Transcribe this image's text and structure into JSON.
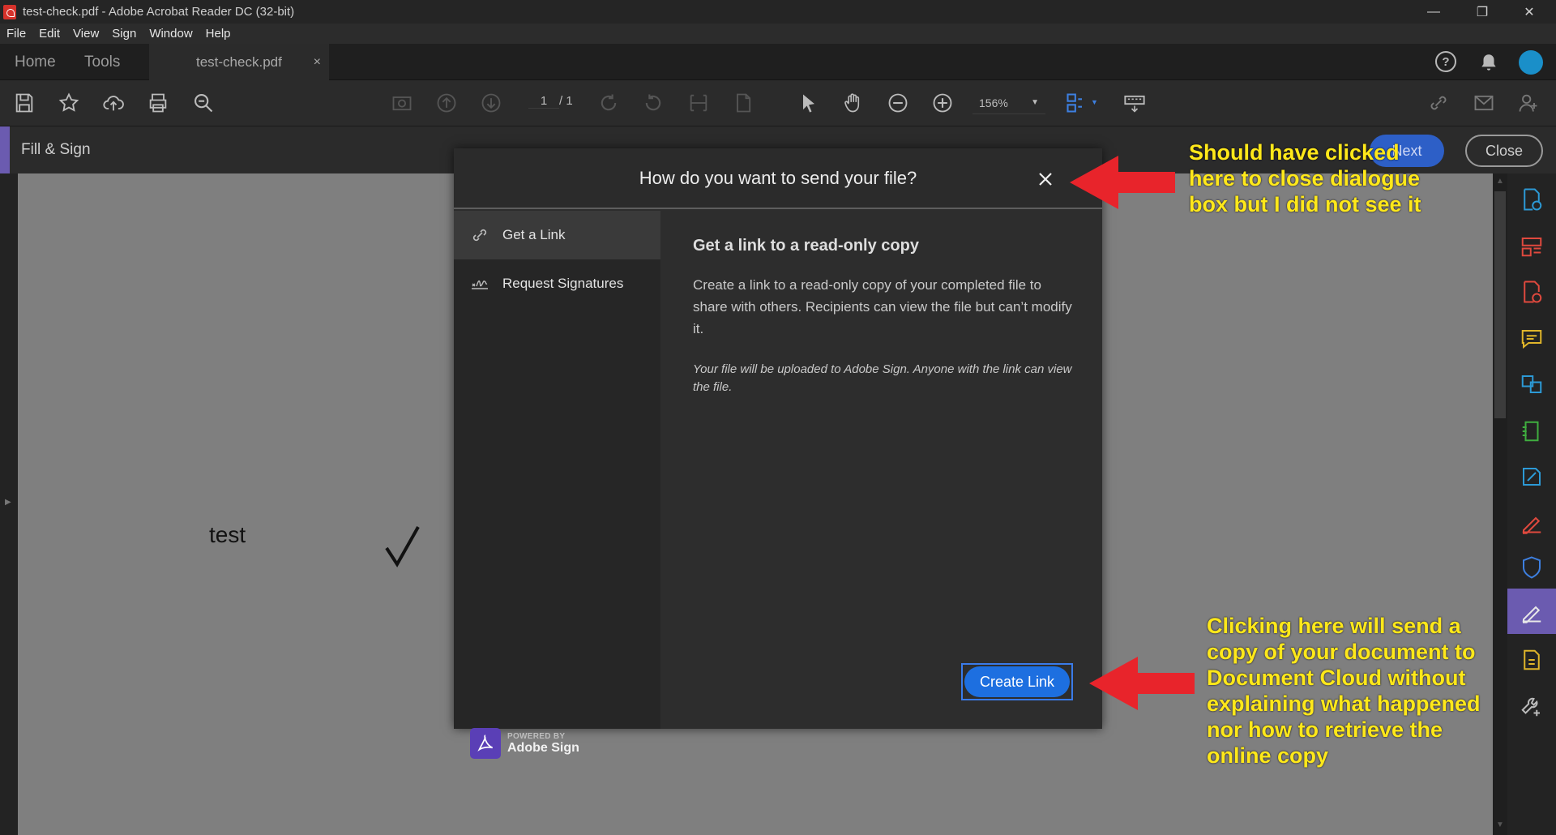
{
  "window": {
    "title": "test-check.pdf - Adobe Acrobat Reader DC (32-bit)",
    "controls": [
      "—",
      "❐",
      "✕"
    ]
  },
  "menu": [
    "File",
    "Edit",
    "View",
    "Sign",
    "Window",
    "Help"
  ],
  "tabs": {
    "home": "Home",
    "tools": "Tools",
    "document": "test-check.pdf",
    "document_close": "×"
  },
  "toolbar": {
    "page_current": "1",
    "page_total": "/ 1",
    "zoom": "156%"
  },
  "fill_sign": {
    "label": "Fill & Sign",
    "next_button": "Next",
    "close_button": "Close"
  },
  "document": {
    "text": "test"
  },
  "modal": {
    "title": "How do you want to send your file?",
    "sidebar": [
      {
        "label": "Get a Link",
        "icon": "link-icon",
        "active": true
      },
      {
        "label": "Request Signatures",
        "icon": "signature-icon",
        "active": false
      }
    ],
    "heading": "Get a link to a read-only copy",
    "description": "Create a link to a read-only copy of your completed file to share with others. Recipients can view the file but can’t modify it.",
    "note": "Your file will be uploaded to Adobe Sign. Anyone with the link can view the file.",
    "powered_small": "POWERED BY",
    "powered_brand": "Adobe Sign",
    "create_button": "Create Link"
  },
  "annotations": {
    "top": [
      "Should have clicked",
      "here to close dialogue",
      "box but I did not see it"
    ],
    "bottom": [
      "Clicking here will send a",
      "copy of your document to",
      "Document Cloud without",
      "explaining what happened",
      "nor how to retrieve the",
      "online copy"
    ]
  },
  "colors": {
    "accent_purple": "#6b5bb0",
    "primary_blue": "#1d6fe0",
    "annotation_yellow": "#ffe81a",
    "arrow_red": "#e8242b"
  }
}
